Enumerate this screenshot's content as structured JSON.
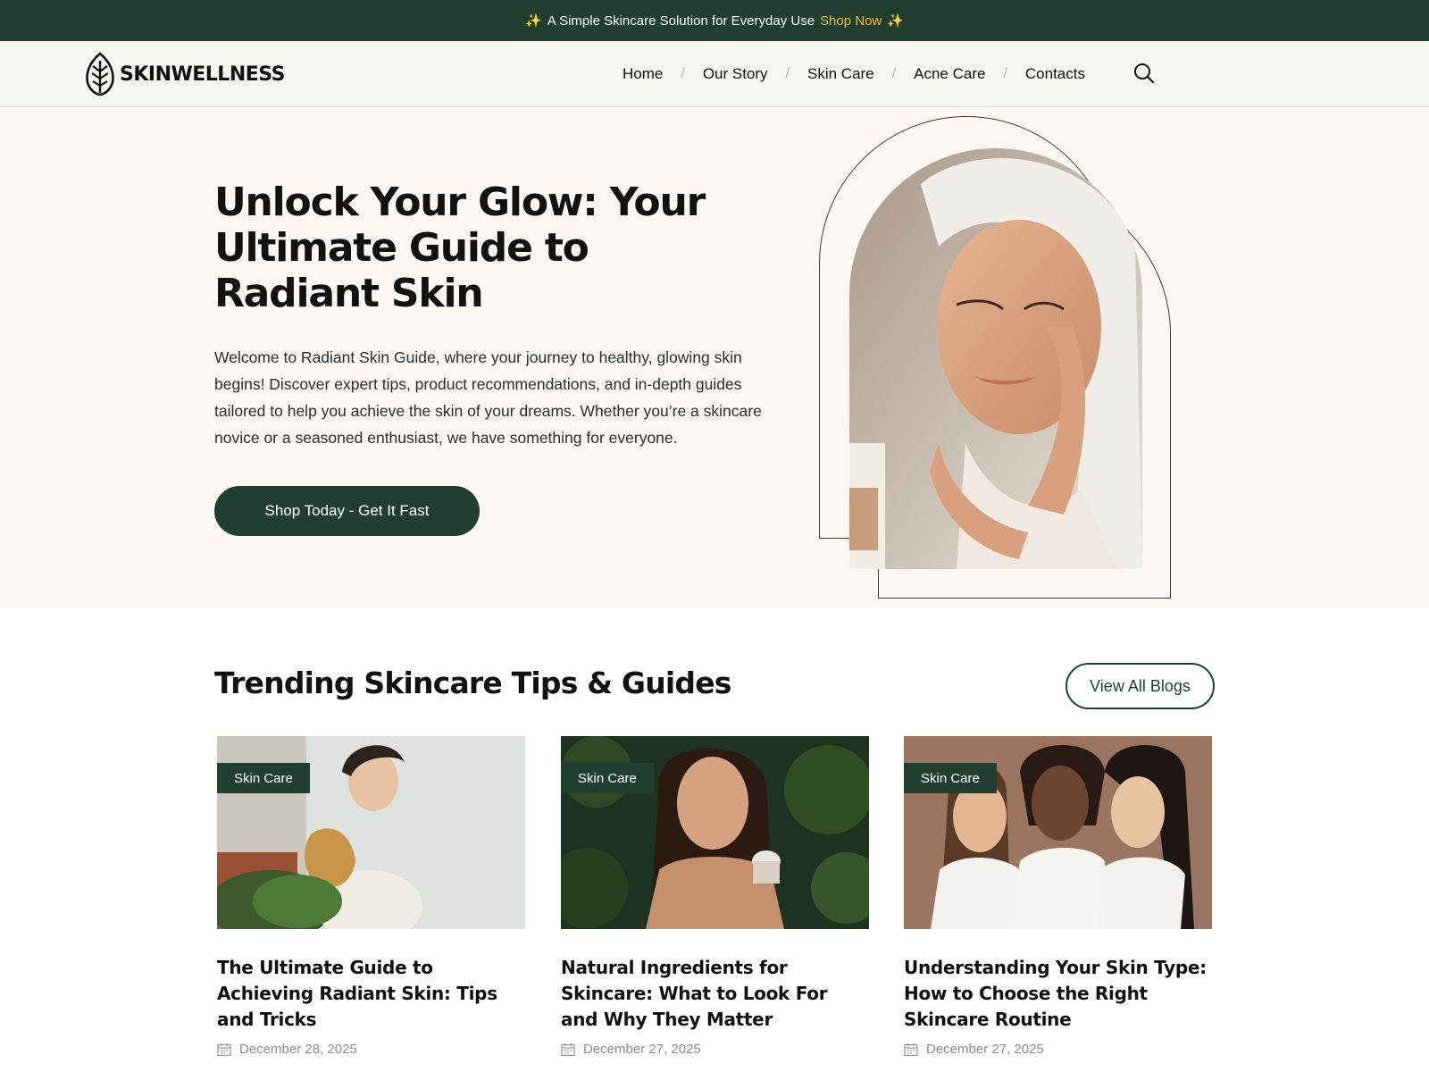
{
  "announcement": {
    "sparkle": "✨",
    "text": "A Simple Skincare Solution for Everyday Use",
    "link": "Shop Now"
  },
  "header": {
    "logo_text": "SKINWELLNESS",
    "nav": [
      "Home",
      "Our Story",
      "Skin Care",
      "Acne Care",
      "Contacts"
    ]
  },
  "hero": {
    "title": "Unlock Your Glow: Your Ultimate Guide to Radiant Skin",
    "description": "Welcome to Radiant Skin Guide, where your journey to healthy, glowing skin begins! Discover expert tips, product recommendations, and in-depth guides tailored to help you achieve the skin of your dreams. Whether you’re a skincare novice or a seasoned enthusiast, we have something for everyone.",
    "cta": "Shop Today - Get It Fast"
  },
  "trending": {
    "title": "Trending Skincare Tips & Guides",
    "view_all": "View All Blogs",
    "posts": [
      {
        "tag": "Skin Care",
        "title": "The Ultimate Guide to Achieving Radiant Skin: Tips and Tricks",
        "date": "December 28, 2025"
      },
      {
        "tag": "Skin Care",
        "title": "Natural Ingredients for Skincare: What to Look For and Why They Matter",
        "date": "December 27, 2025"
      },
      {
        "tag": "Skin Care",
        "title": "Understanding Your Skin Type: How to Choose the Right Skincare Routine",
        "date": "December 27, 2025"
      }
    ]
  },
  "colors": {
    "brand_green": "#213f31",
    "accent_gold": "#f3b93a",
    "hero_bg": "#fcf7f2",
    "header_bg": "#f6f5f0"
  }
}
